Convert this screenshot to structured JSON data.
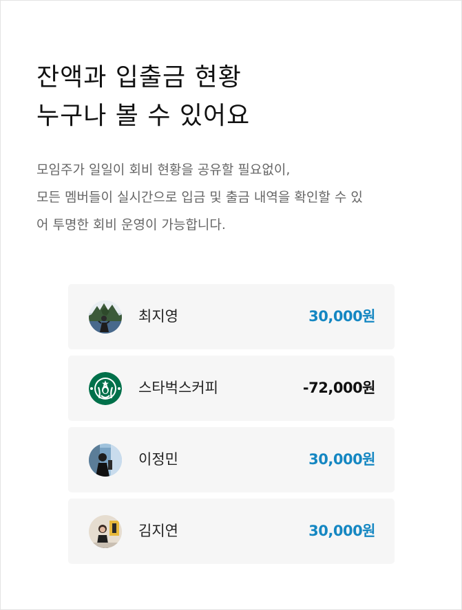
{
  "headline": {
    "line1": "잔액과 입출금 현황",
    "line2": "누구나 볼 수 있어요"
  },
  "description": {
    "line1": "모임주가 일일이 회비 현황을 공유할 필요없이,",
    "line2": "모든 멤버들이 실시간으로 입금 및 출금 내역을 확인할 수 있",
    "line3": "어 투명한 회비 운영이 가능합니다."
  },
  "colors": {
    "deposit": "#1587c2",
    "withdrawal": "#111111",
    "card_background": "#f6f6f6"
  },
  "transactions": [
    {
      "name": "최지영",
      "amount": "30,000원",
      "type": "deposit",
      "avatar": "member-photo-icon"
    },
    {
      "name": "스타벅스커피",
      "amount": "-72,000원",
      "type": "withdrawal",
      "avatar": "starbucks-logo-icon"
    },
    {
      "name": "이정민",
      "amount": "30,000원",
      "type": "deposit",
      "avatar": "member-photo-icon"
    },
    {
      "name": "김지연",
      "amount": "30,000원",
      "type": "deposit",
      "avatar": "member-photo-icon"
    }
  ]
}
